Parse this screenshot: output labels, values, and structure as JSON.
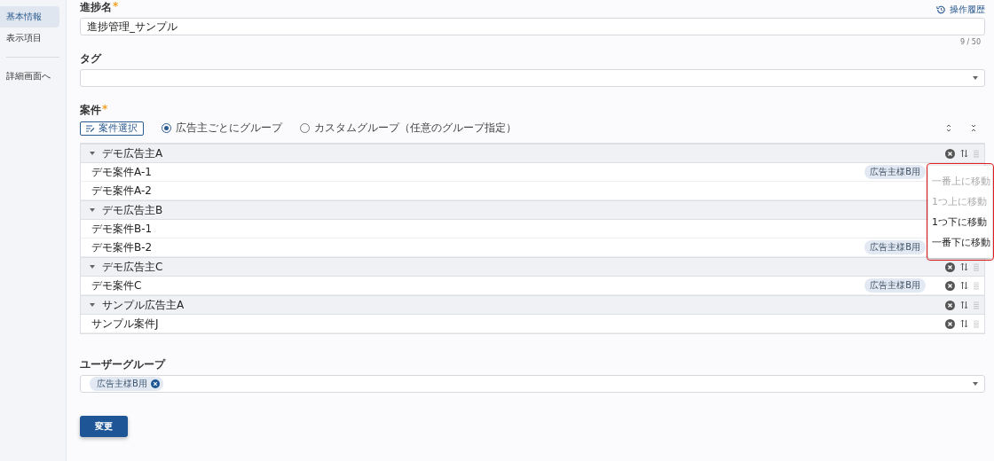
{
  "sidebar": {
    "items": [
      {
        "label": "基本情報",
        "selected": true
      },
      {
        "label": "表示項目",
        "selected": false
      }
    ],
    "link": "詳細画面へ"
  },
  "history_link": "操作履歴",
  "name_field": {
    "label": "進捗名",
    "required": true,
    "required_mark": "*",
    "value": "進捗管理_サンプル",
    "counter": "9 / 50"
  },
  "tag_field": {
    "label": "タグ"
  },
  "projects": {
    "label": "案件",
    "required": true,
    "required_mark": "*",
    "select_button": "案件選択",
    "grouping": [
      {
        "label": "広告主ごとにグループ",
        "selected": true
      },
      {
        "label": "カスタムグループ（任意のグループ指定）",
        "selected": false
      }
    ],
    "groups": [
      {
        "name": "デモ広告主A",
        "expanded": true,
        "actions": true,
        "items": [
          {
            "name": "デモ案件A-1",
            "badge": "広告主様B用",
            "actions": false
          },
          {
            "name": "デモ案件A-2",
            "actions": false
          }
        ]
      },
      {
        "name": "デモ広告主B",
        "expanded": true,
        "actions": false,
        "items": [
          {
            "name": "デモ案件B-1",
            "actions": false
          },
          {
            "name": "デモ案件B-2",
            "badge": "広告主様B用",
            "actions": false
          }
        ]
      },
      {
        "name": "デモ広告主C",
        "expanded": true,
        "actions": true,
        "items": [
          {
            "name": "デモ案件C",
            "badge": "広告主様B用",
            "actions": true
          }
        ]
      },
      {
        "name": "サンプル広告主A",
        "expanded": true,
        "actions": true,
        "items": [
          {
            "name": "サンプル案件J",
            "actions": true
          }
        ]
      }
    ]
  },
  "move_menu": [
    {
      "label": "一番上に移動",
      "disabled": true
    },
    {
      "label": "1つ上に移動",
      "disabled": true
    },
    {
      "label": "1つ下に移動",
      "disabled": false
    },
    {
      "label": "一番下に移動",
      "disabled": false
    }
  ],
  "user_group": {
    "label": "ユーザーグループ",
    "chips": [
      "広告主様B用"
    ]
  },
  "submit_button": "変更"
}
